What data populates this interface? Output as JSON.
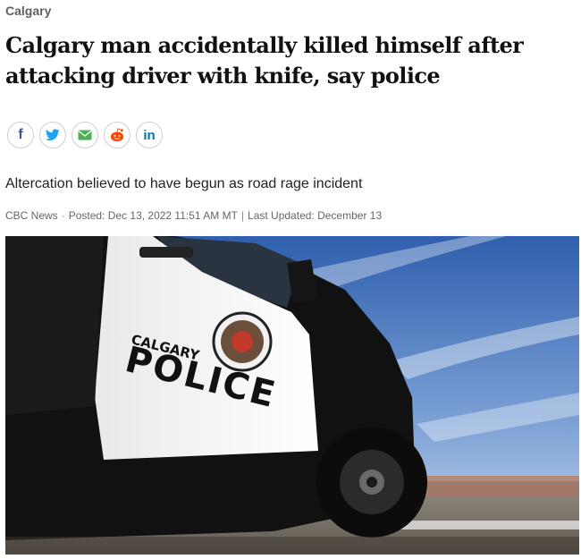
{
  "article": {
    "section": "Calgary",
    "headline": "Calgary man accidentally killed himself after attacking driver with knife, say police",
    "deck": "Altercation believed to have begun as road rage incident",
    "byline": {
      "source": "CBC News",
      "posted": "Posted: Dec 13, 2022 11:51 AM MT",
      "updated": "Last Updated: December 13"
    }
  },
  "share": [
    {
      "network": "facebook",
      "icon": "facebook-icon",
      "glyph": "f",
      "color": "#3b5998"
    },
    {
      "network": "twitter",
      "icon": "twitter-icon",
      "color": "#1da1f2"
    },
    {
      "network": "email",
      "icon": "email-icon",
      "color": "#4caf50"
    },
    {
      "network": "reddit",
      "icon": "reddit-icon",
      "color": "#ff4500"
    },
    {
      "network": "linkedin",
      "icon": "linkedin-icon",
      "glyph": "in",
      "color": "#0077b5"
    }
  ],
  "hero_image": {
    "car_text_top": "CALGARY",
    "car_text_main": "POLICE"
  }
}
